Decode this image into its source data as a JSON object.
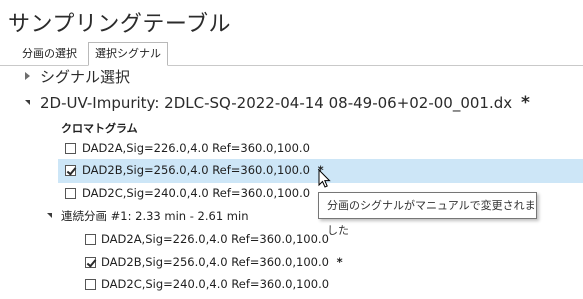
{
  "window": {
    "title": "サンプリングテーブル"
  },
  "tabs": [
    {
      "label": "分画の選択"
    },
    {
      "label": "選択シグナル"
    }
  ],
  "tree": {
    "signal_select": "シグナル選択",
    "file_node": "2D-UV-Impurity: 2DLC-SQ-2022-04-14 08-49-06+02-00_001.dx",
    "file_modified_mark": "*",
    "chromatogram_header": "クロマトグラム",
    "chromatogram_rows": [
      {
        "label": "DAD2A,Sig=226.0,4.0  Ref=360.0,100.0",
        "checked": false,
        "mark": ""
      },
      {
        "label": "DAD2B,Sig=256.0,4.0  Ref=360.0,100.0",
        "checked": true,
        "mark": "*"
      },
      {
        "label": "DAD2C,Sig=240.0,4.0  Ref=360.0,100.0",
        "checked": false,
        "mark": ""
      }
    ],
    "continuous_fraction": "連続分画 #1: 2.33 min - 2.61 min",
    "fraction_rows": [
      {
        "label": "DAD2A,Sig=226.0,4.0  Ref=360.0,100.0",
        "checked": false,
        "mark": ""
      },
      {
        "label": "DAD2B,Sig=256.0,4.0  Ref=360.0,100.0",
        "checked": true,
        "mark": "*"
      },
      {
        "label": "DAD2C,Sig=240.0,4.0  Ref=360.0,100.0",
        "checked": false,
        "mark": ""
      }
    ]
  },
  "tooltip": {
    "text": "分画のシグナルがマニュアルで変更されました"
  },
  "icons": {
    "expand_collapsed": "triangle-right-icon",
    "expand_expanded": "triangle-down-icon",
    "cursor": "mouse-pointer-icon"
  },
  "colors": {
    "selected_row": "#cde6f7",
    "tooltip_border": "#767676"
  }
}
